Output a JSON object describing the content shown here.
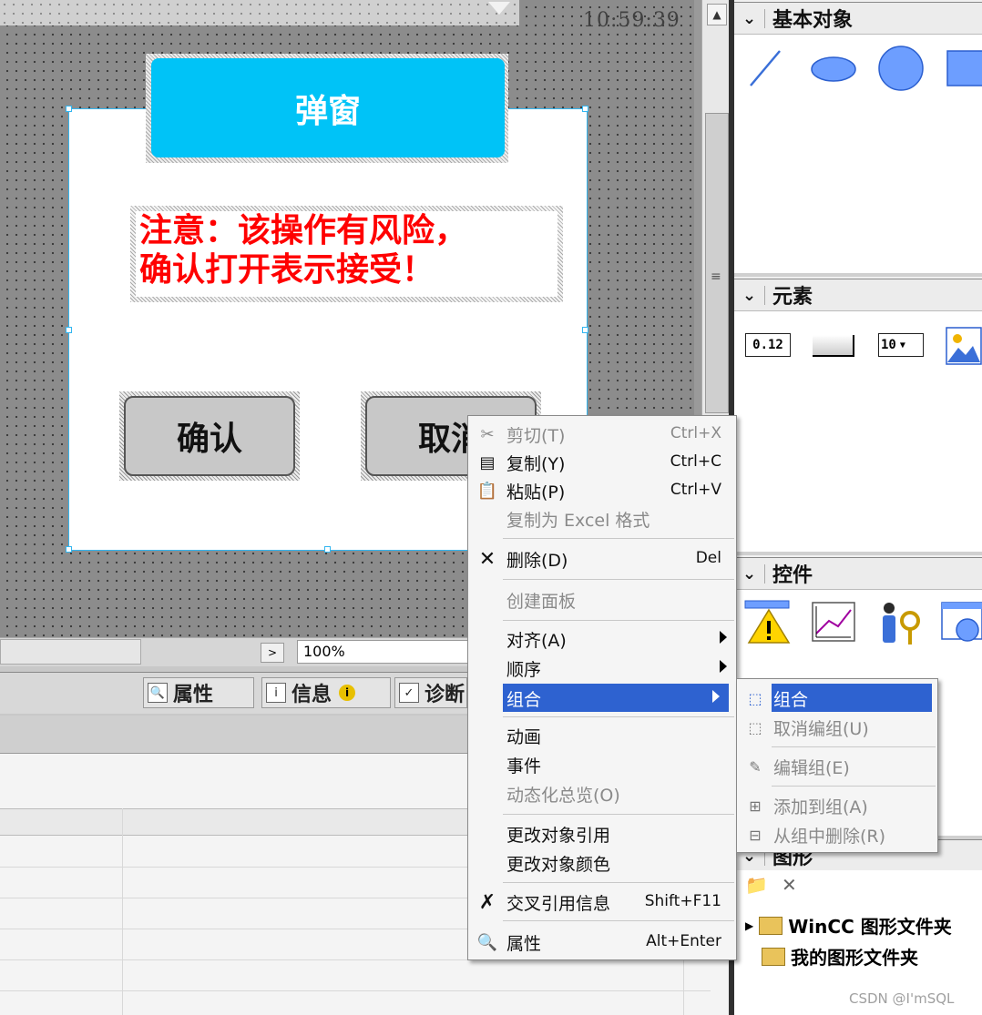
{
  "canvas": {
    "clock": "10:59:39",
    "popup_title": "弹窗",
    "warning_line1": "注意：该操作有风险，",
    "warning_line2": "确认打开表示接受！",
    "confirm_button": "确认",
    "cancel_button": "取消"
  },
  "zoom": {
    "value": "100%"
  },
  "tabs": [
    {
      "label": "属性",
      "icon": "properties-icon"
    },
    {
      "label": "信息",
      "icon": "info-icon"
    },
    {
      "label": "诊断",
      "icon": "diagnostics-icon"
    }
  ],
  "right_panel": {
    "basic_objects": {
      "title": "基本对象",
      "icons": [
        "line-icon",
        "ellipse-icon",
        "circle-icon",
        "rectangle-icon"
      ]
    },
    "elements": {
      "title": "元素",
      "io_field_text": "0.12",
      "dropdown_text": "10"
    },
    "controls": {
      "title": "控件",
      "icons": [
        "alarm-view-icon",
        "trend-view-icon",
        "user-view-icon",
        "web-browser-icon"
      ]
    },
    "graphics": {
      "title": "图形",
      "items": [
        "WinCC 图形文件夹",
        "我的图形文件夹"
      ]
    }
  },
  "context_menu": {
    "items": [
      {
        "label": "剪切(T)",
        "shortcut": "Ctrl+X",
        "icon": "scissors-icon",
        "disabled": true
      },
      {
        "label": "复制(Y)",
        "shortcut": "Ctrl+C",
        "icon": "copy-icon",
        "disabled": false
      },
      {
        "label": "粘贴(P)",
        "shortcut": "Ctrl+V",
        "icon": "paste-icon",
        "disabled": false
      },
      {
        "label": "复制为 Excel 格式",
        "shortcut": "",
        "icon": "",
        "disabled": true
      },
      {
        "label": "删除(D)",
        "shortcut": "Del",
        "icon": "delete-icon",
        "disabled": false
      },
      {
        "label": "创建面板",
        "shortcut": "",
        "icon": "",
        "disabled": true
      },
      {
        "label": "对齐(A)",
        "shortcut": "",
        "icon": "",
        "disabled": false,
        "submenu": true
      },
      {
        "label": "顺序",
        "shortcut": "",
        "icon": "",
        "disabled": false,
        "submenu": true
      },
      {
        "label": "组合",
        "shortcut": "",
        "icon": "",
        "disabled": false,
        "submenu": true,
        "highlighted": true
      },
      {
        "label": "动画",
        "shortcut": "",
        "icon": "",
        "disabled": false
      },
      {
        "label": "事件",
        "shortcut": "",
        "icon": "",
        "disabled": false
      },
      {
        "label": "动态化总览(O)",
        "shortcut": "",
        "icon": "",
        "disabled": true
      },
      {
        "label": "更改对象引用",
        "shortcut": "",
        "icon": "",
        "disabled": false
      },
      {
        "label": "更改对象颜色",
        "shortcut": "",
        "icon": "",
        "disabled": false
      },
      {
        "label": "交叉引用信息",
        "shortcut": "Shift+F11",
        "icon": "cross-reference-icon",
        "disabled": false
      },
      {
        "label": "属性",
        "shortcut": "Alt+Enter",
        "icon": "properties-icon",
        "disabled": false
      }
    ]
  },
  "submenu": {
    "items": [
      {
        "label": "组合",
        "icon": "group-icon",
        "highlighted": true
      },
      {
        "label": "取消编组(U)",
        "icon": "ungroup-icon",
        "disabled": true
      },
      {
        "label": "编辑组(E)",
        "icon": "edit-group-icon",
        "disabled": true
      },
      {
        "label": "添加到组(A)",
        "icon": "add-to-group-icon",
        "disabled": true
      },
      {
        "label": "从组中删除(R)",
        "icon": "remove-from-group-icon",
        "disabled": true
      }
    ]
  },
  "watermark": "CSDN @I'mSQL",
  "colors": {
    "accent_highlight": "#2e62d0",
    "popup_title_bg": "#00c3f7",
    "warning_text": "#ff0000"
  }
}
